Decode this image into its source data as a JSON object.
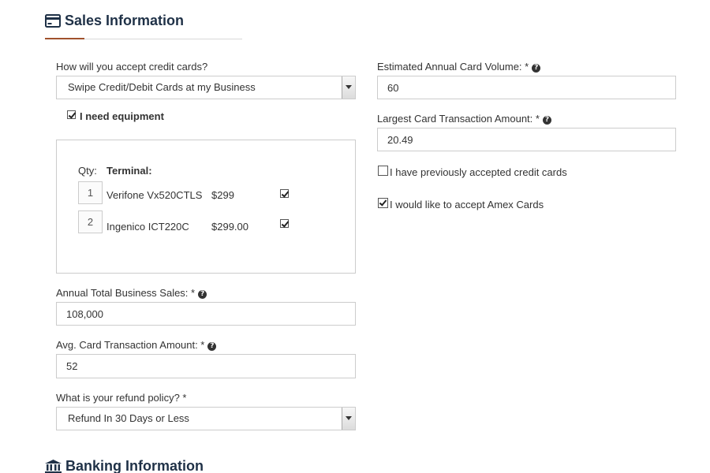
{
  "sales": {
    "title": "Sales Information",
    "icon": "credit-card-icon",
    "accept_label": "How will you accept credit cards?",
    "accept_value": "Swipe Credit/Debit Cards at my Business",
    "need_equipment_label": "I need equipment",
    "need_equipment_checked": true,
    "equipment": {
      "qty_header": "Qty:",
      "terminal_header": "Terminal:",
      "items": [
        {
          "qty": "1",
          "name": "Verifone Vx520CTLS",
          "price": "$299",
          "checked": true
        },
        {
          "qty": "2",
          "name": "Ingenico ICT220C",
          "price": "$299.00",
          "checked": true
        }
      ]
    },
    "annual_sales_label": "Annual Total Business Sales: *",
    "annual_sales_value": "108,000",
    "avg_txn_label": "Avg. Card Transaction Amount: *",
    "avg_txn_value": "52",
    "refund_label": "What is your refund policy? *",
    "refund_value": "Refund In 30 Days or Less",
    "est_volume_label": "Estimated Annual Card Volume: *",
    "est_volume_value": "60",
    "largest_txn_label": "Largest Card Transaction Amount: *",
    "largest_txn_value": "20.49",
    "prev_accepted_label": "I have previously accepted credit cards",
    "prev_accepted_checked": false,
    "amex_label": "I would like to accept Amex Cards",
    "amex_checked": true,
    "help_glyph": "?"
  },
  "banking": {
    "title": "Banking Information",
    "icon": "bank-icon"
  },
  "colors": {
    "heading": "#1f3147",
    "accent_rule": "#a0522d",
    "border": "#cccccc"
  }
}
